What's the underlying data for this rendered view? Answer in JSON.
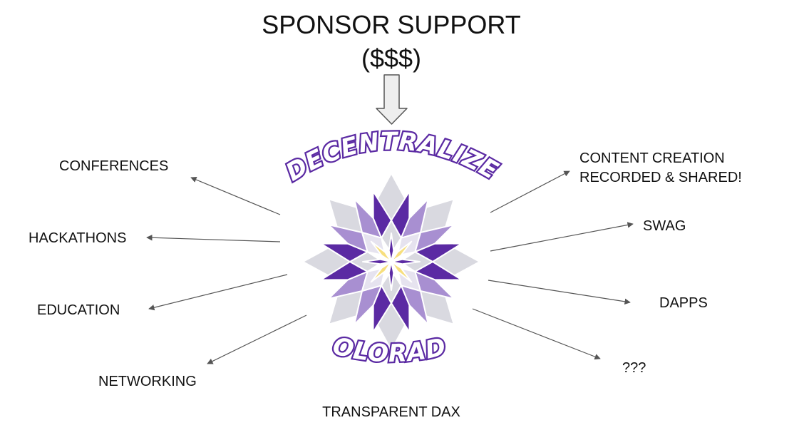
{
  "header": {
    "title_line1": "SPONSOR SUPPORT",
    "title_line2": "($$$)"
  },
  "logo": {
    "top_text": "DECENTRALIZE",
    "bottom_text": "COLORADO",
    "colors": {
      "dark_purple": "#5b2aa3",
      "light_purple": "#a88fd1",
      "grey": "#d9d9e0",
      "yellow": "#f7df7e"
    }
  },
  "left_items": [
    "CONFERENCES",
    "HACKATHONS",
    "EDUCATION",
    "NETWORKING"
  ],
  "right_items": {
    "content_line1": "CONTENT CREATION",
    "content_line2": "RECORDED & SHARED!",
    "swag": "SWAG",
    "dapps": "DAPPS",
    "unknown": "???"
  },
  "footer": {
    "label": "TRANSPARENT DAX"
  },
  "colors": {
    "arrow": "#555555",
    "text": "#111111"
  }
}
